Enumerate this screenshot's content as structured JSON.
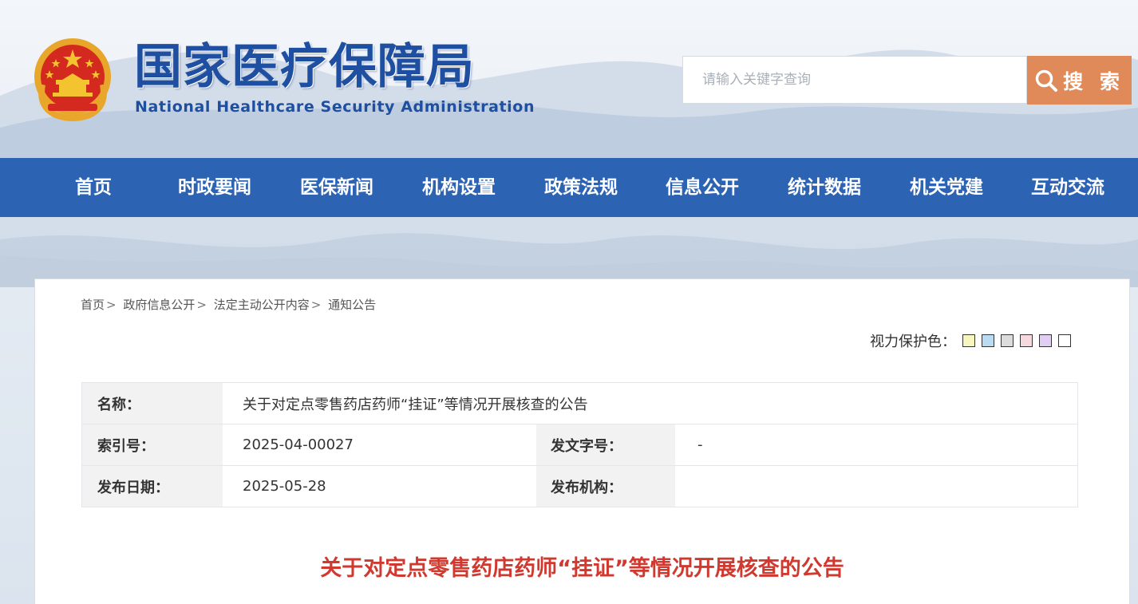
{
  "header": {
    "title": "国家医疗保障局",
    "subtitle": "National Healthcare Security Administration",
    "emblem_icon": "national-emblem-icon"
  },
  "search": {
    "placeholder": "请输入关键字查询",
    "value": "",
    "button_label": "搜 索",
    "button_icon": "search-icon"
  },
  "nav": {
    "items": [
      {
        "label": "首页"
      },
      {
        "label": "时政要闻"
      },
      {
        "label": "医保新闻"
      },
      {
        "label": "机构设置"
      },
      {
        "label": "政策法规"
      },
      {
        "label": "信息公开"
      },
      {
        "label": "统计数据"
      },
      {
        "label": "机关党建"
      },
      {
        "label": "互动交流"
      }
    ]
  },
  "breadcrumb": {
    "items": [
      "首页",
      "政府信息公开",
      "法定主动公开内容",
      "通知公告"
    ],
    "separator": ">"
  },
  "color_protect": {
    "label": "视力保护色：",
    "swatches": [
      "#f8f6bf",
      "#b9dcf3",
      "#dcdcdc",
      "#f6d8df",
      "#e0cff3",
      "#ffffff"
    ]
  },
  "meta": {
    "name_label": "名称：",
    "name_value": "关于对定点零售药店药师“挂证”等情况开展核查的公告",
    "index_label": "索引号：",
    "index_value": "2025-04-00027",
    "doc_no_label": "发文字号：",
    "doc_no_value": "-",
    "date_label": "发布日期：",
    "date_value": "2025-05-28",
    "org_label": "发布机构：",
    "org_value": ""
  },
  "article": {
    "title": "关于对定点零售药店药师“挂证”等情况开展核查的公告"
  },
  "colors": {
    "nav_bg": "#2c63b3",
    "search_button": "#e08a5a",
    "title_red": "#d0392f",
    "brand_blue": "#1e4fa0"
  }
}
